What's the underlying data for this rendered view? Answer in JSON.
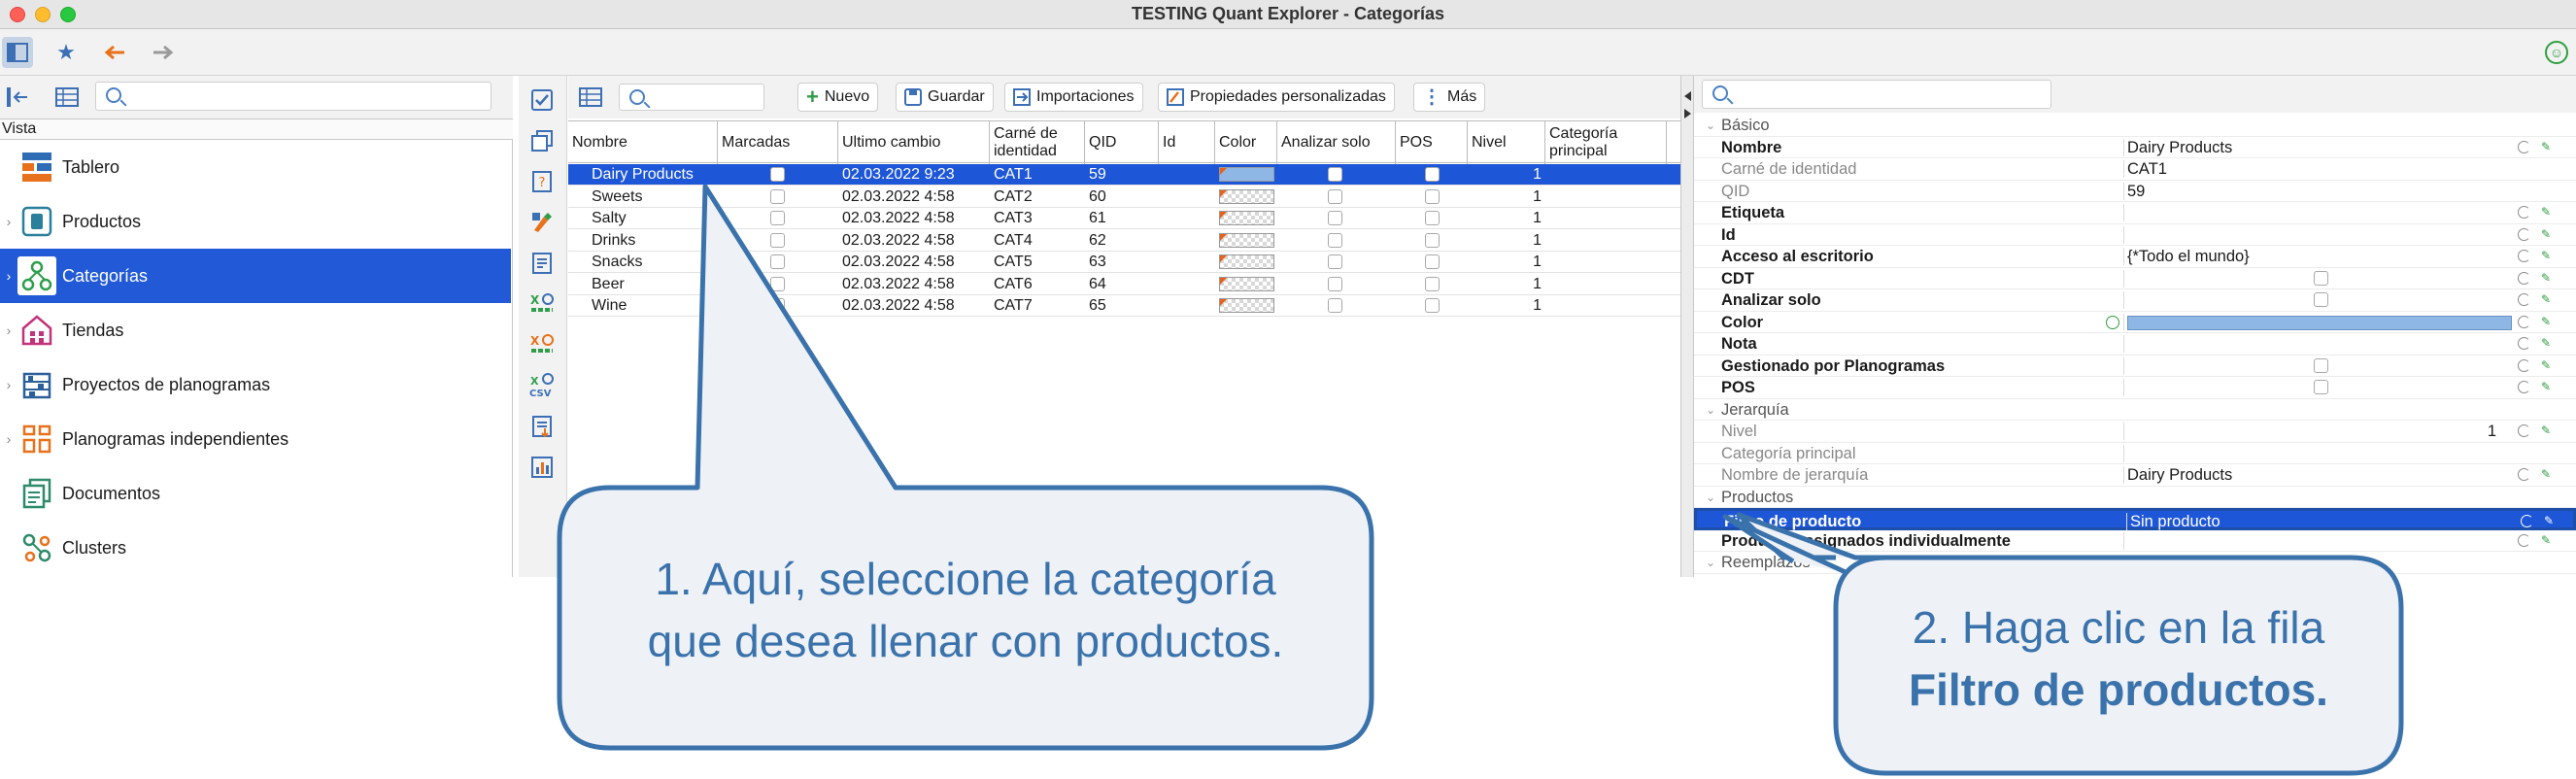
{
  "window": {
    "title": "TESTING Quant Explorer - Categorías"
  },
  "left_panel": {
    "header": "Vista",
    "search_placeholder": "",
    "items": [
      {
        "label": "Tablero",
        "icon": "dashboard-icon"
      },
      {
        "label": "Productos",
        "icon": "products-icon"
      },
      {
        "label": "Categorías",
        "icon": "categories-icon",
        "selected": true
      },
      {
        "label": "Tiendas",
        "icon": "stores-icon"
      },
      {
        "label": "Proyectos de planogramas",
        "icon": "planogram-projects-icon"
      },
      {
        "label": "Planogramas independientes",
        "icon": "independent-planograms-icon"
      },
      {
        "label": "Documentos",
        "icon": "documents-icon"
      },
      {
        "label": "Clusters",
        "icon": "clusters-icon"
      }
    ]
  },
  "toolbar": {
    "new": "Nuevo",
    "save": "Guardar",
    "imports": "Importaciones",
    "custom_props": "Propiedades personalizadas",
    "more": "Más"
  },
  "grid": {
    "columns": [
      "Nombre",
      "Marcadas",
      "Ultimo cambio",
      "Carné de identidad",
      "QID",
      "Id",
      "Color",
      "Analizar solo",
      "POS",
      "Nivel",
      "Categoría principal"
    ],
    "rows": [
      {
        "name": "Dairy Products",
        "changed": "02.03.2022 9:23",
        "code": "CAT1",
        "qid": "59",
        "level": "1",
        "selected": true
      },
      {
        "name": "Sweets",
        "changed": "02.03.2022 4:58",
        "code": "CAT2",
        "qid": "60",
        "level": "1"
      },
      {
        "name": "Salty",
        "changed": "02.03.2022 4:58",
        "code": "CAT3",
        "qid": "61",
        "level": "1"
      },
      {
        "name": "Drinks",
        "changed": "02.03.2022 4:58",
        "code": "CAT4",
        "qid": "62",
        "level": "1"
      },
      {
        "name": "Snacks",
        "changed": "02.03.2022 4:58",
        "code": "CAT5",
        "qid": "63",
        "level": "1"
      },
      {
        "name": "Beer",
        "changed": "02.03.2022 4:58",
        "code": "CAT6",
        "qid": "64",
        "level": "1"
      },
      {
        "name": "Wine",
        "changed": "02.03.2022 4:58",
        "code": "CAT7",
        "qid": "65",
        "level": "1"
      }
    ]
  },
  "properties": {
    "rows": [
      {
        "type": "group",
        "label": "Básico"
      },
      {
        "label": "Nombre",
        "value": "Dairy Products",
        "style": "bold"
      },
      {
        "label": "Carné de identidad",
        "value": "CAT1",
        "style": "gray"
      },
      {
        "label": "QID",
        "value": "59",
        "style": "gray"
      },
      {
        "label": "Etiqueta",
        "value": "",
        "style": "bold"
      },
      {
        "label": "Id",
        "value": "",
        "style": "bold"
      },
      {
        "label": "Acceso al escritorio",
        "value": "{*Todo el mundo}",
        "style": "bold"
      },
      {
        "label": "CDT",
        "value": "",
        "style": "bold",
        "checkbox": true
      },
      {
        "label": "Analizar solo",
        "value": "",
        "style": "bold",
        "checkbox": true
      },
      {
        "label": "Color",
        "value": "",
        "style": "bold",
        "color": true
      },
      {
        "label": "Nota",
        "value": "",
        "style": "bold"
      },
      {
        "label": "Gestionado por Planogramas",
        "value": "",
        "style": "bold",
        "checkbox": true
      },
      {
        "label": "POS",
        "value": "",
        "style": "bold",
        "checkbox": true
      },
      {
        "type": "group",
        "label": "Jerarquía"
      },
      {
        "label": "Nivel",
        "value": "1",
        "style": "gray",
        "align": "right"
      },
      {
        "label": "Categoría principal",
        "value": "",
        "style": "gray"
      },
      {
        "label": "Nombre de jerarquía",
        "value": "Dairy Products",
        "style": "gray"
      },
      {
        "type": "group",
        "label": "Productos"
      },
      {
        "label": "Filtro de producto",
        "value": "Sin producto",
        "style": "bold",
        "selected": true
      },
      {
        "label": "Productos asignados individualmente",
        "value": "",
        "style": "bold"
      },
      {
        "type": "group",
        "label": "Reemplazos"
      }
    ]
  },
  "callouts": {
    "one_line1": "1. Aquí, seleccione la categoría",
    "one_line2": "que desea llenar con productos.",
    "two_line1": "2. Haga clic en la fila",
    "two_line2": "Filtro de productos."
  },
  "colors": {
    "selection": "#1e56d8",
    "callout": "#3a72ab",
    "callout_fill": "#eef1f6"
  }
}
